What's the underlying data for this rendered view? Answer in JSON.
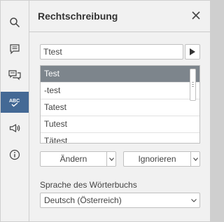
{
  "sidebar": {
    "items": [
      {
        "icon": "search-icon"
      },
      {
        "icon": "comments-icon"
      },
      {
        "icon": "chat-icon"
      },
      {
        "icon": "spellcheck-icon",
        "label": "ABC",
        "active": true
      },
      {
        "icon": "feedback-megaphone-icon"
      },
      {
        "icon": "info-icon"
      }
    ]
  },
  "panel": {
    "title": "Rechtschreibung",
    "word_value": "Ttest",
    "suggestions": [
      "Test",
      "-test",
      "Tatest",
      "Tutest",
      "Tätest"
    ],
    "change_label": "Ändern",
    "ignore_label": "Ignorieren",
    "language_label": "Sprache des Wörterbuchs",
    "language_value": "Deutsch (Österreich)"
  },
  "colors": {
    "accent": "#446995",
    "selected_row": "#7d858c",
    "background": "#f1f1f1"
  }
}
